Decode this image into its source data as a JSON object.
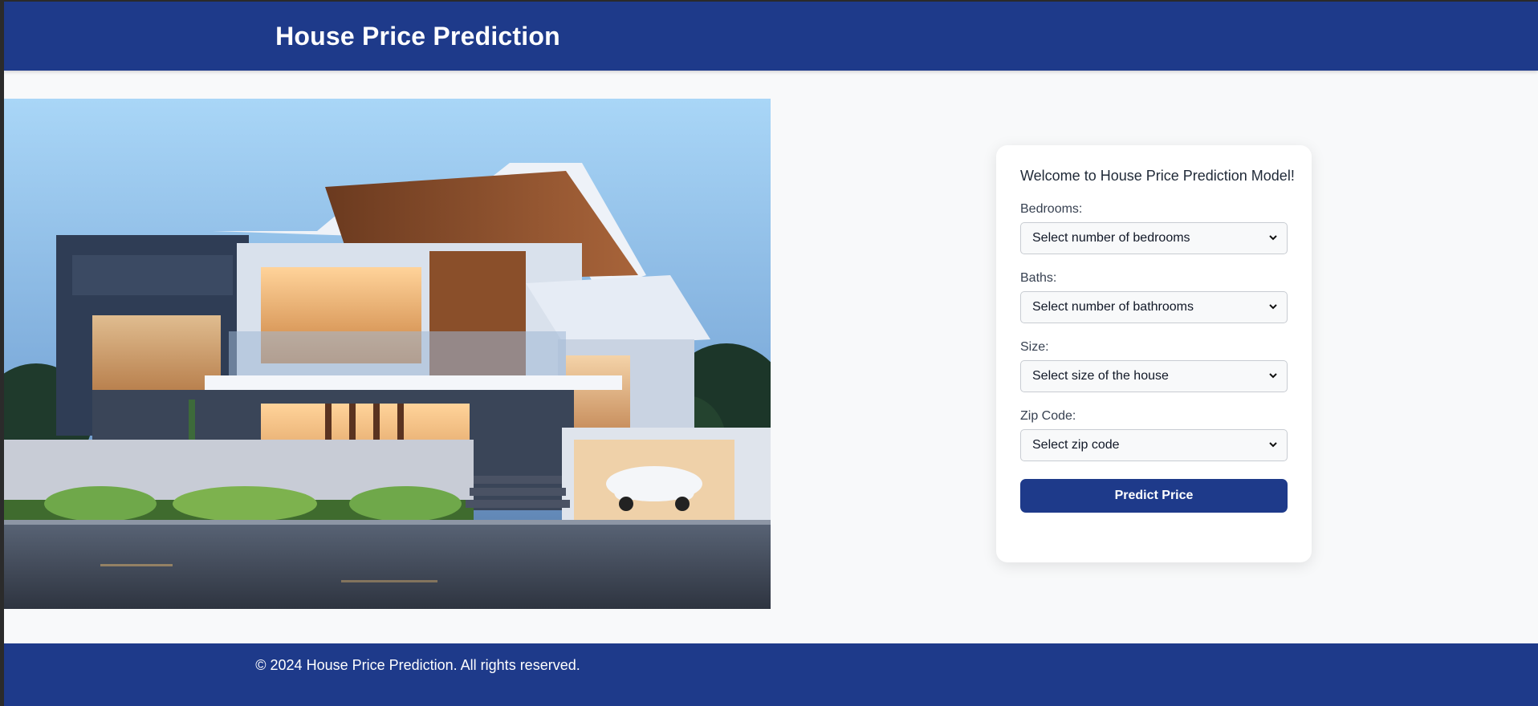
{
  "header": {
    "title": "House Price Prediction"
  },
  "hero_image": {
    "icon": "modern-house-photo"
  },
  "form": {
    "welcome": "Welcome to House Price Prediction Model!",
    "fields": [
      {
        "label": "Bedrooms:",
        "value": "Select number of bedrooms"
      },
      {
        "label": "Baths:",
        "value": "Select number of bathrooms"
      },
      {
        "label": "Size:",
        "value": "Select size of the house"
      },
      {
        "label": "Zip Code:",
        "value": "Select zip code"
      }
    ],
    "submit_label": "Predict Price"
  },
  "footer": {
    "text": "© 2024 House Price Prediction. All rights reserved."
  },
  "colors": {
    "primary": "#1e3a8a",
    "background": "#f8f9fa",
    "card": "#ffffff"
  }
}
